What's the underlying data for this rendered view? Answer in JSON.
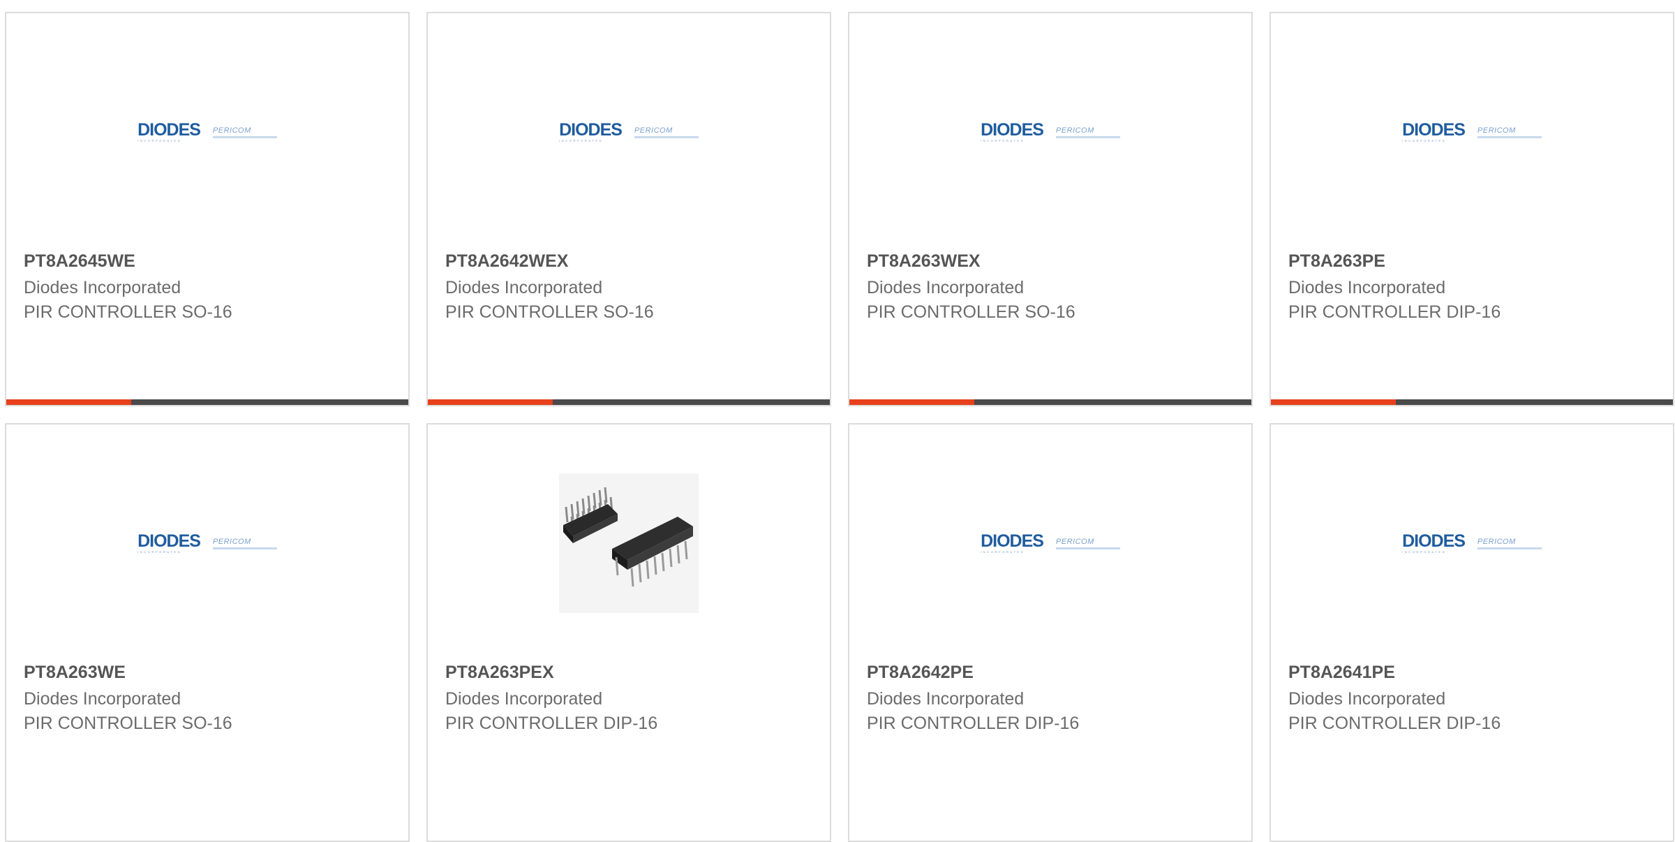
{
  "colors": {
    "accent": "#e8401c",
    "bar": "#4a4a4a",
    "border": "#dcdcdc",
    "part_text": "#555555",
    "body_text": "#6b6b6b",
    "logo_blue": "#1f5c9e"
  },
  "logo": {
    "brand": "DIODES",
    "sub": "INCORPORATED",
    "partner": "PERICOM"
  },
  "products": [
    {
      "part": "PT8A2645WE",
      "manufacturer": "Diodes Incorporated",
      "description": "PIR CONTROLLER SO-16",
      "image": "diodes-pericom-logo",
      "bar_progress": 0.31
    },
    {
      "part": "PT8A2642WEX",
      "manufacturer": "Diodes Incorporated",
      "description": "PIR CONTROLLER SO-16",
      "image": "diodes-pericom-logo",
      "bar_progress": 0.31
    },
    {
      "part": "PT8A263WEX",
      "manufacturer": "Diodes Incorporated",
      "description": "PIR CONTROLLER SO-16",
      "image": "diodes-pericom-logo",
      "bar_progress": 0.31
    },
    {
      "part": "PT8A263PE",
      "manufacturer": "Diodes Incorporated",
      "description": "PIR CONTROLLER DIP-16",
      "image": "diodes-pericom-logo",
      "bar_progress": 0.31
    },
    {
      "part": "PT8A263WE",
      "manufacturer": "Diodes Incorporated",
      "description": "PIR CONTROLLER SO-16",
      "image": "diodes-pericom-logo"
    },
    {
      "part": "PT8A263PEX",
      "manufacturer": "Diodes Incorporated",
      "description": "PIR CONTROLLER DIP-16",
      "image": "dip-16-chip-photo"
    },
    {
      "part": "PT8A2642PE",
      "manufacturer": "Diodes Incorporated",
      "description": "PIR CONTROLLER DIP-16",
      "image": "diodes-pericom-logo"
    },
    {
      "part": "PT8A2641PE",
      "manufacturer": "Diodes Incorporated",
      "description": "PIR CONTROLLER DIP-16",
      "image": "diodes-pericom-logo"
    }
  ]
}
